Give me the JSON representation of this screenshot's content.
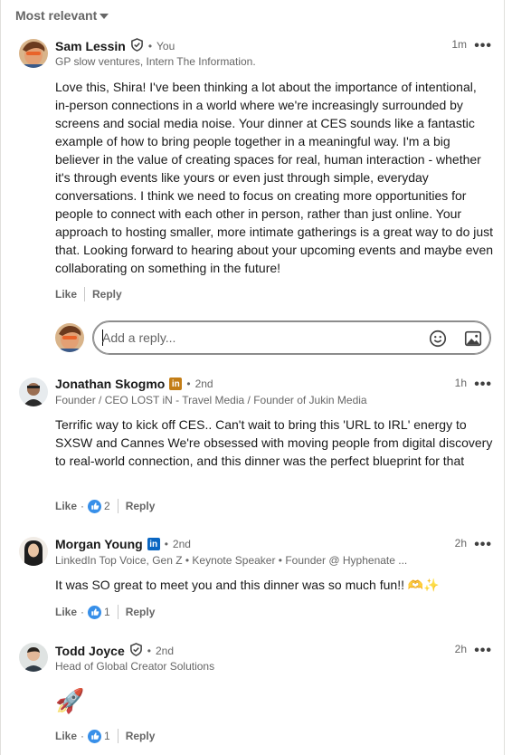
{
  "sort": {
    "label": "Most relevant"
  },
  "comments": [
    {
      "name": "Sam Lessin",
      "relation": "You",
      "headline": "GP slow ventures, Intern The Information.",
      "time": "1m",
      "body": "Love this, Shira! I've been thinking a lot about the importance of intentional, in-person connections in a world where we're increasingly surrounded by screens and social media noise. Your dinner at CES sounds like a fantastic example of how to bring people together in a meaningful way. I'm a big believer in the value of creating spaces for real, human interaction - whether it's through events like yours or even just through simple, everyday conversations. I think we need to focus on creating more opportunities for people to connect with each other in person, rather than just online. Your approach to hosting smaller, more intimate gatherings is a great way to do just that. Looking forward to hearing about your upcoming events and maybe even collaborating on something in the future!",
      "like": "Like",
      "reply": "Reply"
    },
    {
      "name": "Jonathan Skogmo",
      "relation": "2nd",
      "headline": "Founder / CEO LOST iN - Travel Media / Founder of Jukin Media",
      "time": "1h",
      "body": "Terrific way to kick off CES.. Can't wait to bring this 'URL to IRL' energy to SXSW and Cannes We're obsessed with moving people from digital discovery to real-world connection, and this dinner was the perfect blueprint for that",
      "like": "Like",
      "reactions": "2",
      "reply": "Reply"
    },
    {
      "name": "Morgan Young",
      "relation": "2nd",
      "headline": "LinkedIn Top Voice, Gen Z • Keynote Speaker • Founder @ Hyphenate ...",
      "time": "2h",
      "body": "It was SO great to meet you and this dinner was so much fun!! 🫶✨",
      "like": "Like",
      "reactions": "1",
      "reply": "Reply"
    },
    {
      "name": "Todd Joyce",
      "relation": "2nd",
      "headline": "Head of Global Creator Solutions",
      "time": "2h",
      "body": "🚀",
      "like": "Like",
      "reactions": "1",
      "reply": "Reply"
    }
  ],
  "reply_input": {
    "placeholder": "Add a reply..."
  },
  "icons": {
    "verified": "verified-shield-icon",
    "linkedin": "linkedin-badge-icon",
    "emoji": "emoji-icon",
    "image": "image-icon",
    "like_reaction": "like-reaction-icon",
    "more": "more-options-icon"
  },
  "colors": {
    "linkedin_blue": "#0a66c2",
    "reaction_blue": "#378fe9",
    "gold_badge": "#c37d16",
    "muted_text": "#666666"
  }
}
